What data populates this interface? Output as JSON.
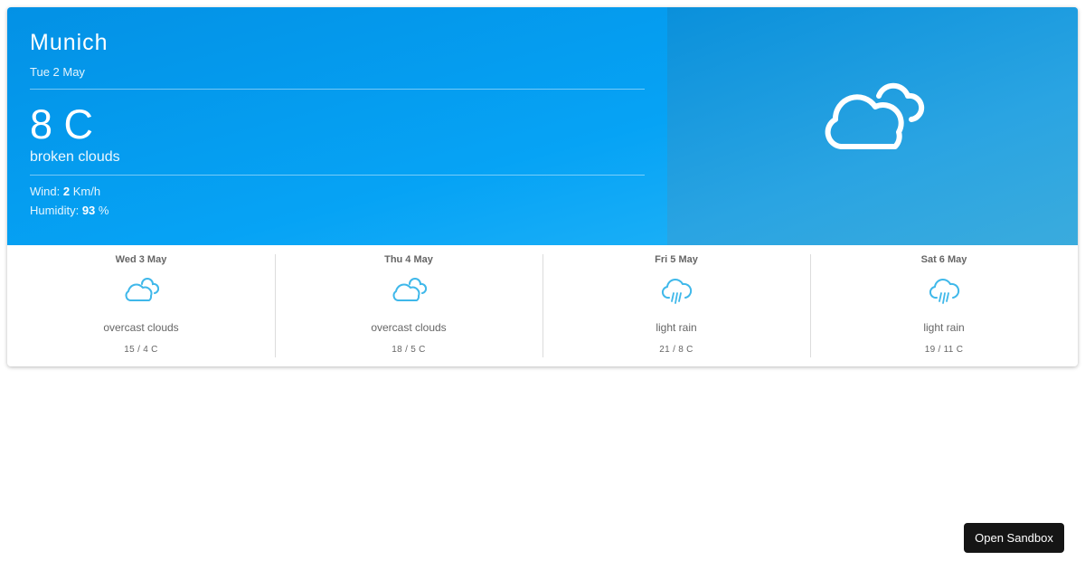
{
  "current": {
    "city": "Munich",
    "date": "Tue 2 May",
    "temperature": "8 C",
    "description": "broken clouds",
    "wind_label": "Wind:",
    "wind_value": "2",
    "wind_unit": "Km/h",
    "humidity_label": "Humidity:",
    "humidity_value": "93",
    "humidity_unit": "%",
    "icon": "broken-clouds-icon"
  },
  "forecast": [
    {
      "day": "Wed 3 May",
      "description": "overcast clouds",
      "range": "15 / 4 C",
      "icon": "overcast-clouds-icon"
    },
    {
      "day": "Thu 4 May",
      "description": "overcast clouds",
      "range": "18 / 5 C",
      "icon": "overcast-clouds-icon"
    },
    {
      "day": "Fri 5 May",
      "description": "light rain",
      "range": "21 / 8 C",
      "icon": "light-rain-icon"
    },
    {
      "day": "Sat 6 May",
      "description": "light rain",
      "range": "19 / 11 C",
      "icon": "light-rain-icon"
    }
  ],
  "sandbox_button": {
    "label": "Open Sandbox"
  },
  "colors": {
    "hero_blue": "#06a3f5",
    "forecast_icon": "#3fb8ea",
    "button_bg": "#151515"
  }
}
